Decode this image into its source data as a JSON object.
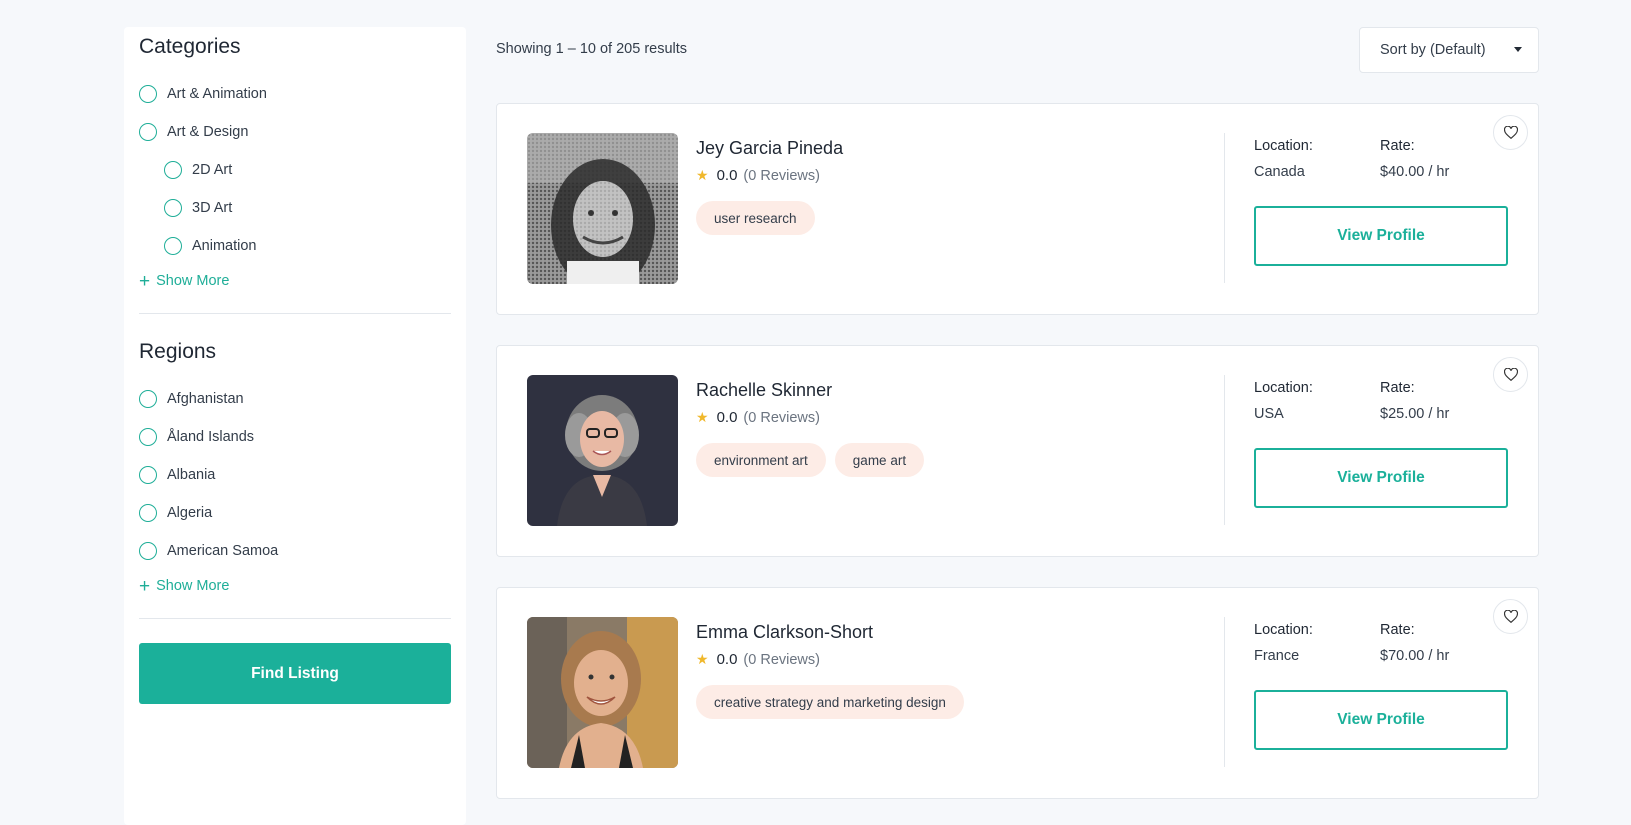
{
  "sidebar": {
    "categories": {
      "title": "Categories",
      "items": [
        {
          "label": "Art & Animation",
          "indent": false
        },
        {
          "label": "Art & Design",
          "indent": false
        },
        {
          "label": "2D Art",
          "indent": true
        },
        {
          "label": "3D Art",
          "indent": true
        },
        {
          "label": "Animation",
          "indent": true
        }
      ],
      "show_more": "Show More"
    },
    "regions": {
      "title": "Regions",
      "items": [
        {
          "label": "Afghanistan"
        },
        {
          "label": "Åland Islands"
        },
        {
          "label": "Albania"
        },
        {
          "label": "Algeria"
        },
        {
          "label": "American Samoa"
        }
      ],
      "show_more": "Show More"
    },
    "find_button": "Find Listing"
  },
  "toolbar": {
    "result_count": "Showing 1 – 10 of 205 results",
    "sort_label": "Sort by (Default)"
  },
  "listings": [
    {
      "name": "Jey Garcia Pineda",
      "score": "0.0",
      "reviews": "(0 Reviews)",
      "tags": [
        "user research"
      ],
      "location_label": "Location:",
      "location": "Canada",
      "rate_label": "Rate:",
      "rate": "$40.00 / hr",
      "view_label": "View Profile"
    },
    {
      "name": "Rachelle Skinner",
      "score": "0.0",
      "reviews": "(0 Reviews)",
      "tags": [
        "environment art",
        "game art"
      ],
      "location_label": "Location:",
      "location": "USA",
      "rate_label": "Rate:",
      "rate": "$25.00 / hr",
      "view_label": "View Profile"
    },
    {
      "name": "Emma Clarkson-Short",
      "score": "0.0",
      "reviews": "(0 Reviews)",
      "tags": [
        "creative strategy and marketing design"
      ],
      "location_label": "Location:",
      "location": "France",
      "rate_label": "Rate:",
      "rate": "$70.00 / hr",
      "view_label": "View Profile"
    }
  ],
  "colors": {
    "accent": "#1bb09a",
    "tag_bg": "#fdece6",
    "star": "#f0b82c",
    "page_bg": "#f6f8fb"
  },
  "icons": {
    "star": "star-icon",
    "heart": "heart-icon",
    "plus": "plus-icon",
    "caret": "caret-down-icon"
  }
}
